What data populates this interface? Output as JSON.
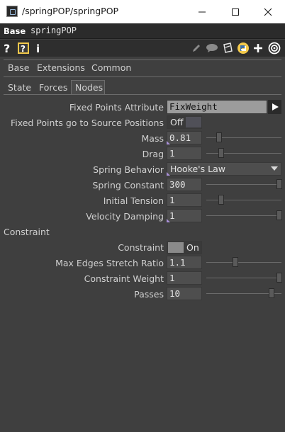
{
  "window": {
    "title": "/springPOP/springPOP"
  },
  "op_header": {
    "type_label": "Base",
    "op_name": "springPOP"
  },
  "tabs_top": [
    "Base",
    "Extensions",
    "Common"
  ],
  "tabs_sub": [
    "State",
    "Forces",
    "Nodes"
  ],
  "params": {
    "fixed_points_attribute": {
      "label": "Fixed Points Attribute",
      "value": "FixWeight"
    },
    "fixed_points_go_to_source": {
      "label": "Fixed Points go to Source Positions",
      "value": "Off"
    },
    "mass": {
      "label": "Mass",
      "value": "0.81",
      "slider_fraction": 0.17
    },
    "drag": {
      "label": "Drag",
      "value": "1",
      "slider_fraction": 0.2
    },
    "spring_behavior": {
      "label": "Spring Behavior",
      "value": "Hooke's Law"
    },
    "spring_constant": {
      "label": "Spring Constant",
      "value": "300",
      "slider_fraction": 1.0
    },
    "initial_tension": {
      "label": "Initial Tension",
      "value": "1",
      "slider_fraction": 0.2
    },
    "velocity_damping": {
      "label": "Velocity Damping",
      "value": "1",
      "slider_fraction": 1.0
    }
  },
  "constraint_section": {
    "title": "Constraint",
    "constraint": {
      "label": "Constraint",
      "value": "On"
    },
    "max_edges_stretch_ratio": {
      "label": "Max Edges Stretch Ratio",
      "value": "1.1",
      "slider_fraction": 0.39
    },
    "constraint_weight": {
      "label": "Constraint Weight",
      "value": "1",
      "slider_fraction": 1.0
    },
    "passes": {
      "label": "Passes",
      "value": "10",
      "slider_fraction": 0.9
    }
  },
  "colors": {
    "panel_bg": "#3f3f3f",
    "field_bg": "#4e4e4e",
    "string_field_bg": "#9c9c9c",
    "toggle_on_bg": "#3a3a3a",
    "python_icon": "#f2c94c"
  },
  "icons": [
    "help-icon",
    "python-help-icon",
    "info-icon",
    "pencil-icon",
    "comment-icon",
    "clipboard-icon",
    "python-icon",
    "plus-icon",
    "target-icon",
    "dropdown-arrow-icon",
    "play-arrow-icon"
  ]
}
